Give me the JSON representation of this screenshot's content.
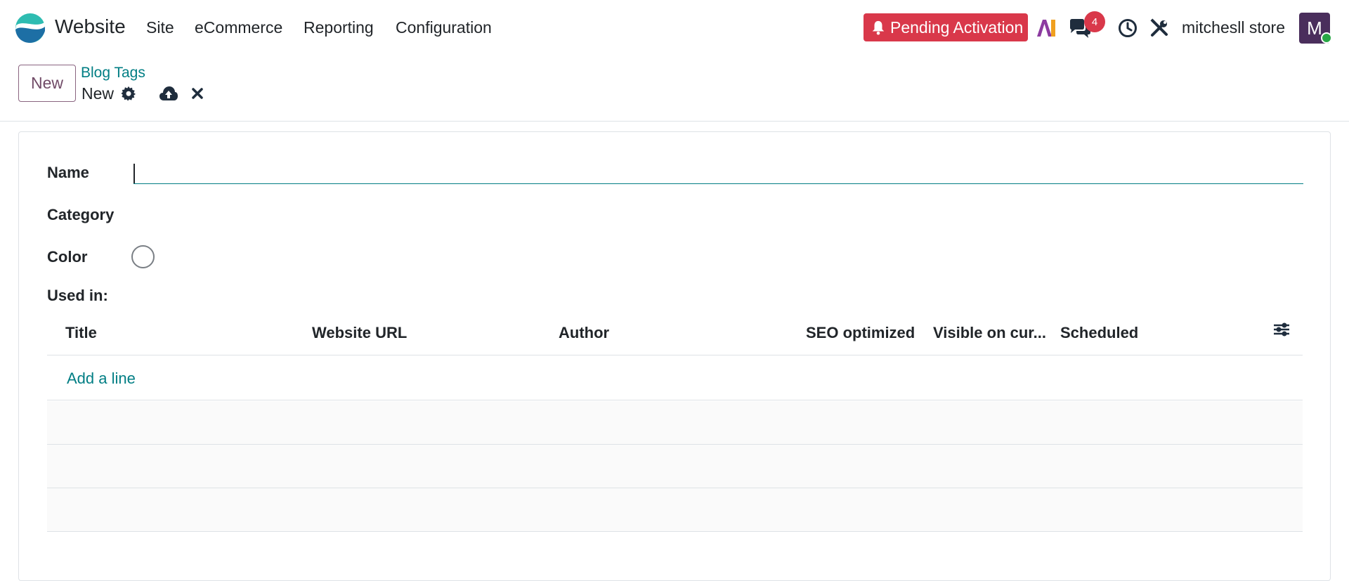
{
  "navbar": {
    "app_name": "Website",
    "menus": [
      "Site",
      "eCommerce",
      "Reporting",
      "Configuration"
    ],
    "pending_label": "Pending Activation",
    "ai_label": "AI",
    "messages_count": "4",
    "store_name": "mitchesll store",
    "avatar_letter": "M"
  },
  "control_panel": {
    "new_button": "New",
    "breadcrumb_parent": "Blog Tags",
    "breadcrumb_current": "New"
  },
  "form": {
    "name_label": "Name",
    "name_value": "",
    "category_label": "Category",
    "color_label": "Color",
    "used_in_label": "Used in:"
  },
  "table": {
    "columns": [
      "Title",
      "Website URL",
      "Author",
      "SEO optimized",
      "Visible on cur...",
      "Scheduled"
    ],
    "add_line": "Add a line"
  },
  "colors": {
    "brand": "#714b67",
    "accent": "#017e84",
    "danger": "#d9384a"
  }
}
